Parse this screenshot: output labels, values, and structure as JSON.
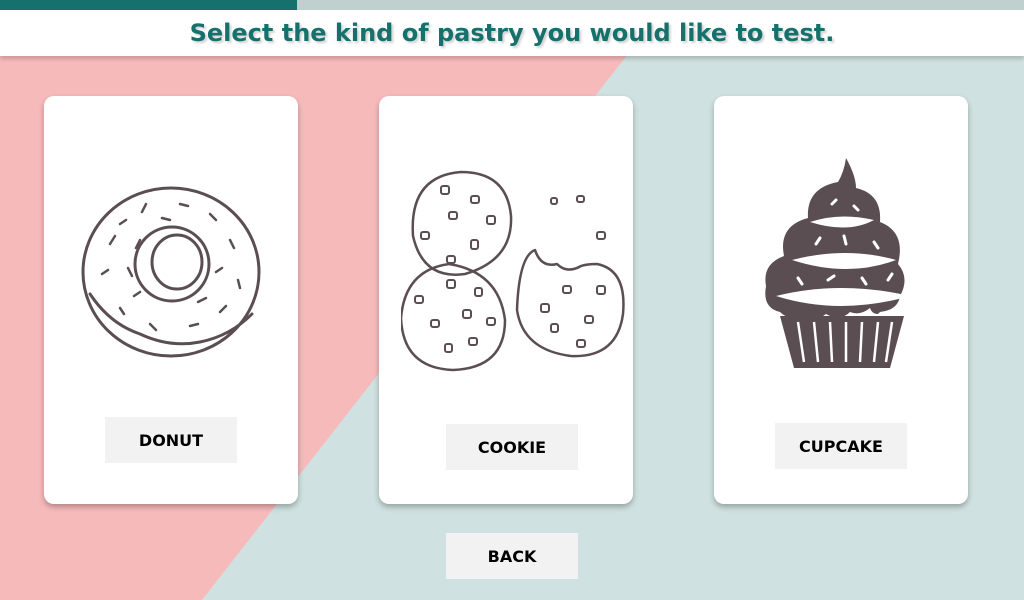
{
  "progress": {
    "fraction": 0.29
  },
  "header": {
    "title": "Select the kind of pastry you would like to test."
  },
  "options": [
    {
      "label": "DONUT",
      "icon": "donut-icon"
    },
    {
      "label": "COOKIE",
      "icon": "cookies-icon"
    },
    {
      "label": "CUPCAKE",
      "icon": "cupcake-icon"
    }
  ],
  "back": {
    "label": "BACK"
  },
  "colors": {
    "accent": "#16716c",
    "pink": "#f7babb",
    "mint": "#cfe1e0",
    "ink": "#5b4e53"
  }
}
